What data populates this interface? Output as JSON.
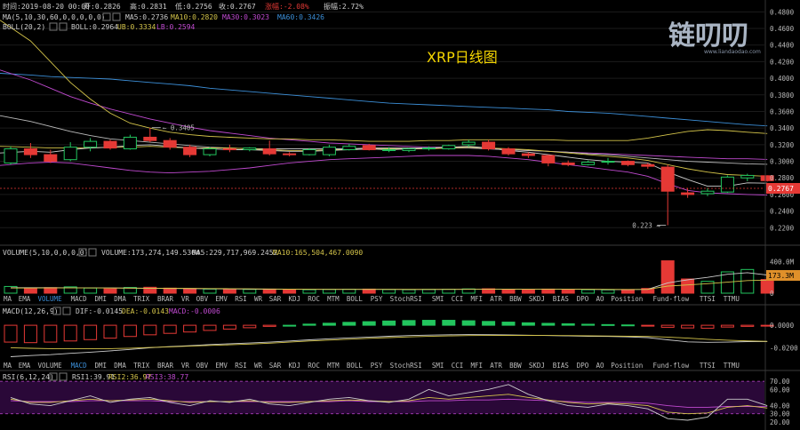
{
  "title": "XRP日线图",
  "watermark": {
    "brand": "链叨叨",
    "url": "www.liandaodao.com"
  },
  "colors": {
    "bg": "#000000",
    "up": "#22c55e",
    "down": "#e53935",
    "grid": "#1b1b1b",
    "ma5": "#cccccc",
    "ma10": "#d4c44a",
    "ma30": "#c04ad0",
    "ma60": "#3c8fd8",
    "boll": "#bbbbbb",
    "ub": "#d4c44a",
    "lb": "#c04ad0",
    "rsi1": "#cccccc",
    "rsi2": "#d4c44a",
    "rsi3": "#c04ad0",
    "rsi_band": "#2a0838",
    "price_badge": "#e53935",
    "vol_badge": "#e0902a"
  },
  "header": {
    "time": "时间:2019-08-20 00:00",
    "open": "开:0.2826",
    "high": "高:0.2831",
    "low": "低:0.2756",
    "close": "收:0.2767",
    "change": "涨幅:-2.08%",
    "amplitude": "振幅:2.72%"
  },
  "ma_row": {
    "label": "MA(5,10,30,60,0,0,0,0,0)",
    "ma5": "MA5:0.2736",
    "ma10": "MA10:0.2820",
    "ma30": "MA30:0.3023",
    "ma60": "MA60:0.3426"
  },
  "boll_row": {
    "label": "BOLL(20,2)",
    "boll": "BOLL:0.2964",
    "ub": "UB:0.3334",
    "lb": "LB:0.2594"
  },
  "volume_row": {
    "label": "VOLUME(5,10,0,0,0,0)",
    "volume": "VOLUME:173,274,149.5304",
    "ma5": "MA5:229,717,969.2452",
    "ma10": "MA10:165,504,467.0090"
  },
  "macd_row": {
    "label": "MACD(12,26,9)",
    "dif": "DIF:-0.0145",
    "dea": "DEA:-0.0143",
    "macd": "MACD:-0.0006"
  },
  "rsi_row": {
    "label": "RSI(6,12,24)",
    "rsi1": "RSI1:39.91",
    "rsi2": "RSI2:36.97",
    "rsi3": "RSI3:38.77"
  },
  "indicator_tabs": [
    "MA",
    "EMA",
    "VOLUME",
    "MACD",
    "DMI",
    "DMA",
    "TRIX",
    "BRAR",
    "VR",
    "OBV",
    "EMV",
    "RSI",
    "WR",
    "SAR",
    "KDJ",
    "ROC",
    "MTM",
    "BOLL",
    "PSY",
    "StochRSI",
    "SMI",
    "CCI",
    "MFI",
    "ATR",
    "BBW",
    "SKDJ",
    "BIAS",
    "DPO",
    "AO",
    "Position",
    "Fund-flow",
    "TTSI",
    "TTMU"
  ],
  "tabs_active_1": "VOLUME",
  "tabs_active_2": "MACD",
  "price_badge": "0.2767",
  "vol_badge": "173.3M",
  "chart_data": {
    "type": "candlestick",
    "title": "XRP日线图",
    "candles": [
      {
        "o": 0.298,
        "h": 0.318,
        "l": 0.296,
        "c": 0.315
      },
      {
        "o": 0.315,
        "h": 0.322,
        "l": 0.304,
        "c": 0.308
      },
      {
        "o": 0.308,
        "h": 0.314,
        "l": 0.298,
        "c": 0.3
      },
      {
        "o": 0.302,
        "h": 0.323,
        "l": 0.3,
        "c": 0.317
      },
      {
        "o": 0.317,
        "h": 0.328,
        "l": 0.312,
        "c": 0.324
      },
      {
        "o": 0.324,
        "h": 0.326,
        "l": 0.314,
        "c": 0.316
      },
      {
        "o": 0.315,
        "h": 0.332,
        "l": 0.314,
        "c": 0.329
      },
      {
        "o": 0.329,
        "h": 0.3405,
        "l": 0.323,
        "c": 0.325
      },
      {
        "o": 0.325,
        "h": 0.328,
        "l": 0.314,
        "c": 0.317
      },
      {
        "o": 0.317,
        "h": 0.32,
        "l": 0.305,
        "c": 0.308
      },
      {
        "o": 0.308,
        "h": 0.317,
        "l": 0.306,
        "c": 0.315
      },
      {
        "o": 0.315,
        "h": 0.32,
        "l": 0.311,
        "c": 0.314
      },
      {
        "o": 0.314,
        "h": 0.317,
        "l": 0.312,
        "c": 0.316
      },
      {
        "o": 0.315,
        "h": 0.325,
        "l": 0.307,
        "c": 0.309
      },
      {
        "o": 0.309,
        "h": 0.311,
        "l": 0.306,
        "c": 0.308
      },
      {
        "o": 0.308,
        "h": 0.316,
        "l": 0.307,
        "c": 0.314
      },
      {
        "o": 0.308,
        "h": 0.32,
        "l": 0.306,
        "c": 0.317
      },
      {
        "o": 0.314,
        "h": 0.321,
        "l": 0.313,
        "c": 0.318
      },
      {
        "o": 0.319,
        "h": 0.321,
        "l": 0.313,
        "c": 0.314
      },
      {
        "o": 0.313,
        "h": 0.317,
        "l": 0.311,
        "c": 0.314
      },
      {
        "o": 0.313,
        "h": 0.316,
        "l": 0.311,
        "c": 0.315
      },
      {
        "o": 0.315,
        "h": 0.318,
        "l": 0.313,
        "c": 0.316
      },
      {
        "o": 0.315,
        "h": 0.32,
        "l": 0.314,
        "c": 0.319
      },
      {
        "o": 0.32,
        "h": 0.326,
        "l": 0.317,
        "c": 0.323
      },
      {
        "o": 0.323,
        "h": 0.326,
        "l": 0.313,
        "c": 0.315
      },
      {
        "o": 0.315,
        "h": 0.317,
        "l": 0.307,
        "c": 0.309
      },
      {
        "o": 0.309,
        "h": 0.311,
        "l": 0.304,
        "c": 0.307
      },
      {
        "o": 0.307,
        "h": 0.308,
        "l": 0.294,
        "c": 0.298
      },
      {
        "o": 0.298,
        "h": 0.301,
        "l": 0.294,
        "c": 0.296
      },
      {
        "o": 0.296,
        "h": 0.301,
        "l": 0.295,
        "c": 0.299
      },
      {
        "o": 0.299,
        "h": 0.304,
        "l": 0.296,
        "c": 0.3
      },
      {
        "o": 0.3,
        "h": 0.301,
        "l": 0.294,
        "c": 0.296
      },
      {
        "o": 0.296,
        "h": 0.298,
        "l": 0.291,
        "c": 0.294
      },
      {
        "o": 0.293,
        "h": 0.296,
        "l": 0.223,
        "c": 0.264
      },
      {
        "o": 0.262,
        "h": 0.268,
        "l": 0.256,
        "c": 0.26
      },
      {
        "o": 0.261,
        "h": 0.268,
        "l": 0.258,
        "c": 0.264
      },
      {
        "o": 0.263,
        "h": 0.283,
        "l": 0.262,
        "c": 0.281
      },
      {
        "o": 0.28,
        "h": 0.285,
        "l": 0.276,
        "c": 0.283
      },
      {
        "o": 0.2826,
        "h": 0.2831,
        "l": 0.2756,
        "c": 0.2767
      }
    ],
    "candle_x_start": 6,
    "candle_x_step": 23.2,
    "price_axis": {
      "min": 0.2,
      "max": 0.49,
      "ticks": [
        "0.4800",
        "0.4600",
        "0.4400",
        "0.4200",
        "0.4000",
        "0.3800",
        "0.3600",
        "0.3400",
        "0.3200",
        "0.3000",
        "0.2800",
        "0.2600",
        "0.2400",
        "0.2200"
      ]
    },
    "ma_lines": {
      "ma5": [
        0.31,
        0.312,
        0.311,
        0.314,
        0.316,
        0.317,
        0.319,
        0.32,
        0.318,
        0.316,
        0.315,
        0.314,
        0.314,
        0.313,
        0.312,
        0.312,
        0.313,
        0.314,
        0.315,
        0.314,
        0.315,
        0.316,
        0.317,
        0.318,
        0.316,
        0.313,
        0.311,
        0.308,
        0.305,
        0.302,
        0.3,
        0.299,
        0.298,
        0.287,
        0.278,
        0.27,
        0.27,
        0.274,
        0.2736
      ],
      "ma10": [
        0.318,
        0.317,
        0.316,
        0.316,
        0.316,
        0.317,
        0.317,
        0.318,
        0.317,
        0.316,
        0.316,
        0.316,
        0.315,
        0.314,
        0.313,
        0.313,
        0.314,
        0.314,
        0.315,
        0.315,
        0.315,
        0.315,
        0.316,
        0.317,
        0.316,
        0.315,
        0.314,
        0.312,
        0.31,
        0.308,
        0.306,
        0.304,
        0.301,
        0.296,
        0.291,
        0.287,
        0.284,
        0.283,
        0.282
      ],
      "ma30": [
        0.41,
        0.398,
        0.388,
        0.378,
        0.37,
        0.363,
        0.357,
        0.351,
        0.346,
        0.341,
        0.337,
        0.334,
        0.331,
        0.328,
        0.326,
        0.324,
        0.322,
        0.321,
        0.32,
        0.319,
        0.318,
        0.317,
        0.317,
        0.316,
        0.315,
        0.314,
        0.313,
        0.312,
        0.311,
        0.31,
        0.309,
        0.308,
        0.307,
        0.306,
        0.305,
        0.304,
        0.303,
        0.303,
        0.3023
      ],
      "ma60": [
        0.406,
        0.404,
        0.402,
        0.401,
        0.4,
        0.399,
        0.397,
        0.395,
        0.393,
        0.391,
        0.388,
        0.386,
        0.384,
        0.382,
        0.38,
        0.378,
        0.376,
        0.374,
        0.372,
        0.37,
        0.369,
        0.368,
        0.367,
        0.366,
        0.365,
        0.364,
        0.363,
        0.362,
        0.36,
        0.359,
        0.358,
        0.356,
        0.354,
        0.352,
        0.35,
        0.348,
        0.346,
        0.344,
        0.3426
      ],
      "ub": [
        0.47,
        0.445,
        0.42,
        0.395,
        0.375,
        0.358,
        0.346,
        0.34,
        0.335,
        0.332,
        0.33,
        0.329,
        0.328,
        0.327,
        0.327,
        0.326,
        0.326,
        0.325,
        0.324,
        0.324,
        0.324,
        0.325,
        0.325,
        0.326,
        0.326,
        0.326,
        0.326,
        0.326,
        0.325,
        0.325,
        0.325,
        0.325,
        0.328,
        0.332,
        0.336,
        0.338,
        0.337,
        0.335,
        0.3334
      ],
      "boll": [
        0.355,
        0.348,
        0.342,
        0.336,
        0.331,
        0.327,
        0.325,
        0.323,
        0.321,
        0.319,
        0.317,
        0.316,
        0.315,
        0.315,
        0.315,
        0.315,
        0.315,
        0.315,
        0.316,
        0.316,
        0.316,
        0.316,
        0.316,
        0.316,
        0.315,
        0.314,
        0.313,
        0.312,
        0.311,
        0.309,
        0.308,
        0.306,
        0.304,
        0.302,
        0.3,
        0.299,
        0.298,
        0.297,
        0.2964
      ],
      "lb": [
        0.295,
        0.298,
        0.299,
        0.298,
        0.295,
        0.292,
        0.289,
        0.287,
        0.286,
        0.287,
        0.288,
        0.29,
        0.292,
        0.295,
        0.298,
        0.3,
        0.302,
        0.303,
        0.304,
        0.305,
        0.306,
        0.307,
        0.307,
        0.307,
        0.306,
        0.304,
        0.302,
        0.299,
        0.296,
        0.293,
        0.29,
        0.287,
        0.282,
        0.273,
        0.265,
        0.262,
        0.261,
        0.26,
        0.2594
      ]
    },
    "annotations": [
      {
        "label": "0.3405",
        "candle": 7,
        "price": 0.3405
      },
      {
        "label": "0.223",
        "candle": 33,
        "price": 0.223
      }
    ],
    "volume": {
      "axis": {
        "max": 450,
        "ticks": [
          "400.0M",
          "200.0M",
          "0"
        ]
      },
      "values_m": [
        85,
        60,
        70,
        80,
        65,
        55,
        72,
        75,
        64,
        58,
        52,
        50,
        48,
        52,
        46,
        44,
        48,
        50,
        52,
        46,
        44,
        48,
        50,
        54,
        56,
        48,
        46,
        52,
        48,
        44,
        42,
        46,
        60,
        410,
        180,
        150,
        270,
        300,
        173.3
      ],
      "ma5_m": [
        70,
        70,
        70,
        68,
        66,
        66,
        64,
        62,
        60,
        58,
        56,
        54,
        52,
        50,
        49,
        48,
        48,
        48,
        48,
        48,
        47,
        47,
        48,
        49,
        50,
        51,
        50,
        50,
        49,
        48,
        46,
        46,
        48,
        130,
        170,
        200,
        240,
        260,
        229.7
      ],
      "ma10_m": [
        65,
        65,
        66,
        66,
        66,
        65,
        64,
        63,
        62,
        61,
        59,
        57,
        55,
        53,
        51,
        49,
        48,
        48,
        48,
        48,
        48,
        48,
        48,
        48,
        49,
        49,
        49,
        49,
        49,
        49,
        48,
        47,
        48,
        90,
        105,
        120,
        140,
        160,
        165.5
      ]
    },
    "macd": {
      "axis": {
        "min": -0.03,
        "max": 0.008,
        "ticks": [
          "0.0000",
          "-0.0200"
        ]
      },
      "hist": [
        -0.015,
        -0.0155,
        -0.015,
        -0.014,
        -0.0128,
        -0.0115,
        -0.01,
        -0.0085,
        -0.0072,
        -0.006,
        -0.0046,
        -0.0034,
        -0.0022,
        -0.001,
        0.0,
        0.001,
        0.0018,
        0.0026,
        0.0032,
        0.0038,
        0.0042,
        0.0044,
        0.0044,
        0.004,
        0.0034,
        0.0028,
        0.0022,
        0.0017,
        0.0013,
        0.0009,
        0.0006,
        0.0003,
        -0.0004,
        -0.0018,
        -0.0024,
        -0.0026,
        -0.0016,
        -0.001,
        -0.0006
      ],
      "dif": [
        -0.028,
        -0.027,
        -0.0262,
        -0.025,
        -0.024,
        -0.0228,
        -0.0215,
        -0.02,
        -0.019,
        -0.0182,
        -0.0172,
        -0.0165,
        -0.0158,
        -0.015,
        -0.014,
        -0.013,
        -0.012,
        -0.0112,
        -0.0105,
        -0.0098,
        -0.0092,
        -0.0088,
        -0.0085,
        -0.0083,
        -0.0084,
        -0.0086,
        -0.0089,
        -0.0092,
        -0.0095,
        -0.0098,
        -0.01,
        -0.0104,
        -0.011,
        -0.013,
        -0.0148,
        -0.0152,
        -0.015,
        -0.0146,
        -0.0145
      ],
      "dea": [
        -0.02,
        -0.0205,
        -0.0208,
        -0.021,
        -0.021,
        -0.0208,
        -0.0204,
        -0.0198,
        -0.0192,
        -0.0186,
        -0.018,
        -0.0174,
        -0.0168,
        -0.016,
        -0.015,
        -0.014,
        -0.0132,
        -0.0124,
        -0.0116,
        -0.011,
        -0.0104,
        -0.0099,
        -0.0095,
        -0.0092,
        -0.0091,
        -0.009,
        -0.009,
        -0.0091,
        -0.0092,
        -0.0094,
        -0.0096,
        -0.0098,
        -0.01,
        -0.0105,
        -0.0115,
        -0.0125,
        -0.0133,
        -0.0139,
        -0.0143
      ]
    },
    "rsi": {
      "axis": {
        "min": 10,
        "max": 80,
        "ticks": [
          "70.00",
          "60.00",
          "40.00",
          "30.00",
          "20.00"
        ]
      },
      "band": [
        30,
        70
      ],
      "rsi1": [
        50,
        42,
        40,
        46,
        52,
        44,
        48,
        50,
        44,
        40,
        46,
        44,
        48,
        42,
        40,
        44,
        48,
        50,
        46,
        44,
        48,
        60,
        52,
        56,
        60,
        66,
        54,
        46,
        40,
        38,
        42,
        40,
        36,
        24,
        22,
        26,
        48,
        48,
        40
      ],
      "rsi2": [
        48,
        44,
        44,
        46,
        48,
        46,
        47,
        48,
        46,
        44,
        45,
        45,
        46,
        44,
        44,
        45,
        46,
        47,
        46,
        45,
        46,
        50,
        48,
        50,
        52,
        54,
        50,
        47,
        44,
        42,
        43,
        42,
        40,
        32,
        30,
        31,
        38,
        40,
        37
      ],
      "rsi3": [
        46,
        45,
        45,
        45,
        46,
        46,
        46,
        46,
        45,
        45,
        45,
        45,
        45,
        45,
        45,
        45,
        45,
        46,
        45,
        45,
        45,
        46,
        46,
        47,
        47,
        48,
        47,
        46,
        45,
        44,
        44,
        44,
        43,
        40,
        38,
        38,
        39,
        39,
        38.8
      ]
    }
  }
}
